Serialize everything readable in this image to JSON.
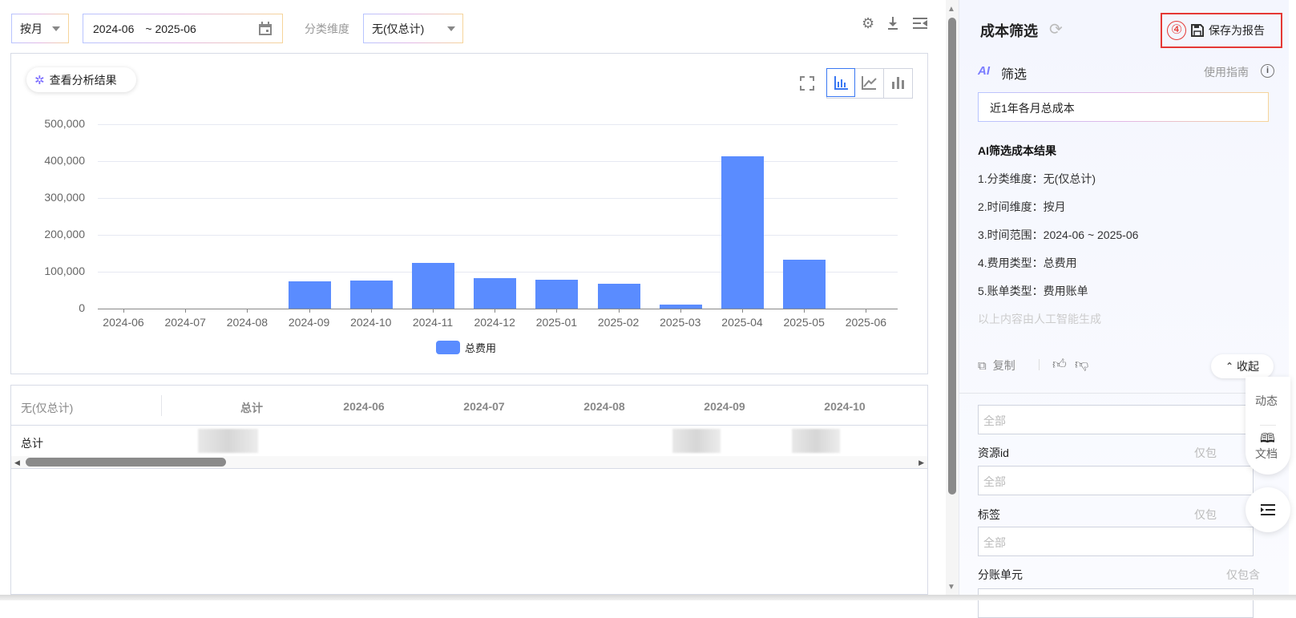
{
  "toolbar": {
    "granularity": "按月",
    "date_start": "2024-06",
    "date_end": "~ 2025-06",
    "dimension_label": "分类维度",
    "dimension_value": "无(仅总计)"
  },
  "chart_panel": {
    "analysis_button": "查看分析结果"
  },
  "chart_data": {
    "type": "bar",
    "title": "",
    "xlabel": "",
    "ylabel": "",
    "categories": [
      "2024-06",
      "2024-07",
      "2024-08",
      "2024-09",
      "2024-10",
      "2024-11",
      "2024-12",
      "2025-01",
      "2025-02",
      "2025-03",
      "2025-04",
      "2025-05",
      "2025-06"
    ],
    "series": [
      {
        "name": "总费用",
        "values": [
          0,
          0,
          0,
          73000,
          76000,
          124000,
          83000,
          78000,
          67000,
          11000,
          414000,
          132000,
          0
        ]
      }
    ],
    "ylim": [
      0,
      500000
    ],
    "yticks": [
      "0",
      "100,000",
      "200,000",
      "300,000",
      "400,000",
      "500,000"
    ],
    "grid": true,
    "legend": "bottom-center",
    "color": "#5a8cff"
  },
  "table": {
    "headers": [
      "无(仅总计)",
      "总计",
      "2024-06",
      "2024-07",
      "2024-08",
      "2024-09",
      "2024-10"
    ],
    "row_label": "总计"
  },
  "right_panel": {
    "title": "成本筛选",
    "step_marker": "④",
    "save_label": "保存为报告",
    "ai_title": "筛选",
    "ai_badge": "AI",
    "guide": "使用指南",
    "query": "近1年各月总成本",
    "result_title": "AI筛选成本结果",
    "results": [
      "1.分类维度：无(仅总计)",
      "2.时间维度：按月",
      "3.时间范围：2024-06 ~ 2025-06",
      "4.费用类型：总费用",
      "5.账单类型：费用账单"
    ],
    "disclaimer": "以上内容由人工智能生成",
    "copy": "复制",
    "collapse": "收起",
    "filters": [
      {
        "label": "",
        "hint": "",
        "placeholder": "全部"
      },
      {
        "label": "资源id",
        "hint": "仅包",
        "placeholder": "全部"
      },
      {
        "label": "标签",
        "hint": "仅包",
        "placeholder": "全部"
      },
      {
        "label": "分账单元",
        "hint": "仅包含",
        "placeholder": ""
      }
    ],
    "float_dynamic": "动态",
    "float_docs": "文档"
  }
}
